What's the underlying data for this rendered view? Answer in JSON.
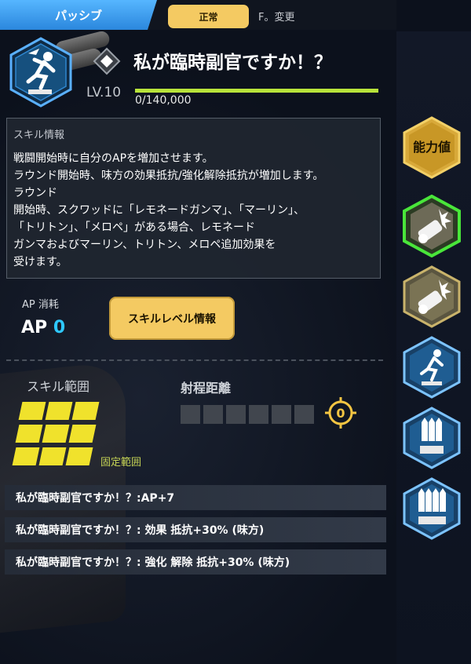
{
  "tabs": {
    "passive": "パッシブ",
    "normal": "正常",
    "change": "F。変更"
  },
  "skill": {
    "title": "私が臨時副官ですか！？",
    "level": "LV.10",
    "xp": "0/140,000",
    "xp_fraction": 1.0,
    "icon": "running-soldier-icon"
  },
  "info": {
    "heading": "スキル情報",
    "lines": [
      "戦闘開始時に自分のAPを増加させます。",
      "ラウンド開始時、味方の効果抵抗/強化解除抵抗が増加します。",
      "ラウンド",
      "開始時、スクワッドに「レモネードガンマ」、「マーリン」、",
      "「トリトン」、「メロペ」がある場合、レモネード",
      "ガンマおよびマーリン、トリトン、メロペ追加効果を",
      "受けます。"
    ]
  },
  "ap": {
    "label": "AP 消耗",
    "prefix": "AP",
    "value": "0"
  },
  "level_button": "スキルレベル情報",
  "range": {
    "label": "スキル範囲",
    "fixed_label": "固定範囲",
    "distance_label": "射程距離",
    "distance_value": "0"
  },
  "effects": [
    "私が臨時副官ですか！？:AP+7",
    "私が臨時副官ですか！？: 効果 抵抗+30% (味方)",
    "私が臨時副官ですか！？: 強化 解除 抵抗+30% (味方)"
  ],
  "sidebar": {
    "stats_label": "能力値",
    "buttons": [
      "explosion-cannon-icon-active",
      "explosion-cannon-icon",
      "running-soldier-icon",
      "triple-missile-icon",
      "quad-missile-icon"
    ]
  },
  "colors": {
    "accent_blue": "#2ec8ff",
    "gold": "#f4ca62",
    "xp_green": "#b8e33a",
    "range_yellow": "#f0e22c"
  }
}
